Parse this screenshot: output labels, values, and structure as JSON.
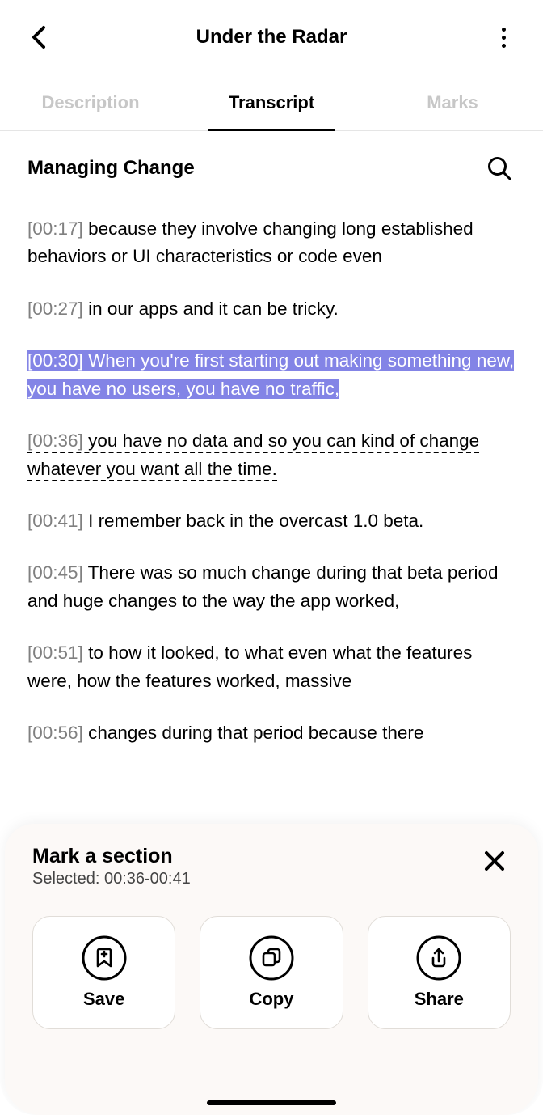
{
  "header": {
    "title": "Under the Radar"
  },
  "tabs": {
    "items": [
      {
        "label": "Description",
        "active": false
      },
      {
        "label": "Transcript",
        "active": true
      },
      {
        "label": "Marks",
        "active": false
      }
    ]
  },
  "section": {
    "title": "Managing Change"
  },
  "transcript": {
    "segments": [
      {
        "time": "[00:17]",
        "text": " because they involve changing long established behaviors or UI characteristics or code even",
        "selected": false,
        "dotted": false
      },
      {
        "time": "[00:27]",
        "text": " in our apps and it can be tricky.",
        "selected": false,
        "dotted": false
      },
      {
        "time": "[00:30]",
        "text": " When you're first starting out making something new, you have no users, you have no traffic,",
        "selected": true,
        "dotted": false
      },
      {
        "time": "[00:36]",
        "text": " you have no data and so you can kind of change whatever you want all the time.",
        "selected": false,
        "dotted": true
      },
      {
        "time": "[00:41]",
        "text": " I remember back in the overcast 1.0 beta.",
        "selected": false,
        "dotted": false
      },
      {
        "time": "[00:45]",
        "text": " There was so much change during that beta period and huge changes to the way the app worked,",
        "selected": false,
        "dotted": false
      },
      {
        "time": "[00:51]",
        "text": " to how it looked, to what even what the features were, how the features worked, massive",
        "selected": false,
        "dotted": false
      },
      {
        "time": "[00:56]",
        "text": " changes during that period because there",
        "selected": false,
        "dotted": false
      }
    ]
  },
  "sheet": {
    "title": "Mark a section",
    "subtitle": "Selected: 00:36-00:41",
    "actions": {
      "save": "Save",
      "copy": "Copy",
      "share": "Share"
    }
  }
}
